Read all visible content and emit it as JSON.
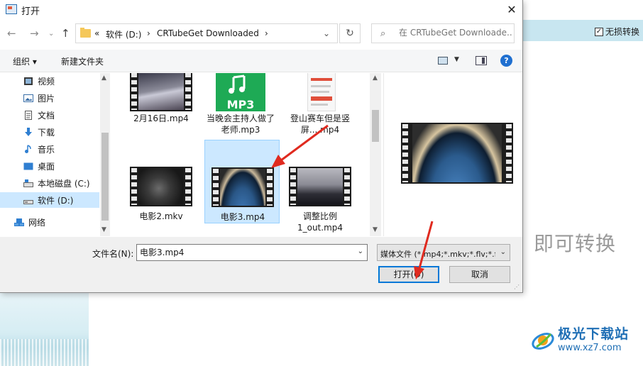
{
  "dialog": {
    "title": "打开",
    "close_label": "✕"
  },
  "nav": {
    "back": "←",
    "forward": "→",
    "recent": "⌄",
    "up": "↑",
    "breadcrumb": [
      "«",
      "软件 (D:)",
      "›",
      "CRTubeGet Downloaded",
      "›"
    ],
    "refresh": "↻"
  },
  "search": {
    "placeholder": "在 CRTubeGet Downloade..."
  },
  "toolbar": {
    "organize": "组织 ▾",
    "new_folder": "新建文件夹",
    "help": "?"
  },
  "sidebar": {
    "items": [
      {
        "label": "视频",
        "icon": "video-folder-icon"
      },
      {
        "label": "图片",
        "icon": "pictures-folder-icon"
      },
      {
        "label": "文档",
        "icon": "documents-folder-icon"
      },
      {
        "label": "下载",
        "icon": "download-icon"
      },
      {
        "label": "音乐",
        "icon": "music-icon"
      },
      {
        "label": "桌面",
        "icon": "desktop-icon"
      },
      {
        "label": "本地磁盘 (C:)",
        "icon": "local-disk-icon"
      },
      {
        "label": "软件 (D:)",
        "icon": "drive-icon",
        "selected": true
      },
      {
        "label": "网络",
        "icon": "network-icon"
      }
    ]
  },
  "files": [
    {
      "name": "2月16日.mp4",
      "type": "video"
    },
    {
      "name": "当晚会主持人做了老师.mp3",
      "type": "audio",
      "badge": "MP3"
    },
    {
      "name": "登山赛车但是竖屏....mp4",
      "type": "video-phone"
    },
    {
      "name": "电影2.mkv",
      "type": "video"
    },
    {
      "name": "电影3.mp4",
      "type": "video",
      "selected": true
    },
    {
      "name": "调整比例1_out.mp4",
      "type": "video"
    }
  ],
  "bottom": {
    "filename_label": "文件名(N):",
    "filename_value": "电影3.mp4",
    "filetype_value": "媒体文件 (*.mp4;*.mkv;*.flv;*.f",
    "open_label": "打开(O)",
    "cancel_label": "取消"
  },
  "background_app": {
    "lossless_label": "无损转换",
    "lossless_checked": true,
    "hint_text": "即可转换"
  },
  "watermark": {
    "name": "极光下载站",
    "url": "www.xz7.com"
  },
  "colors": {
    "accent": "#0078d7",
    "selection": "#cce8ff",
    "annotation_arrow": "#e02a1f"
  }
}
